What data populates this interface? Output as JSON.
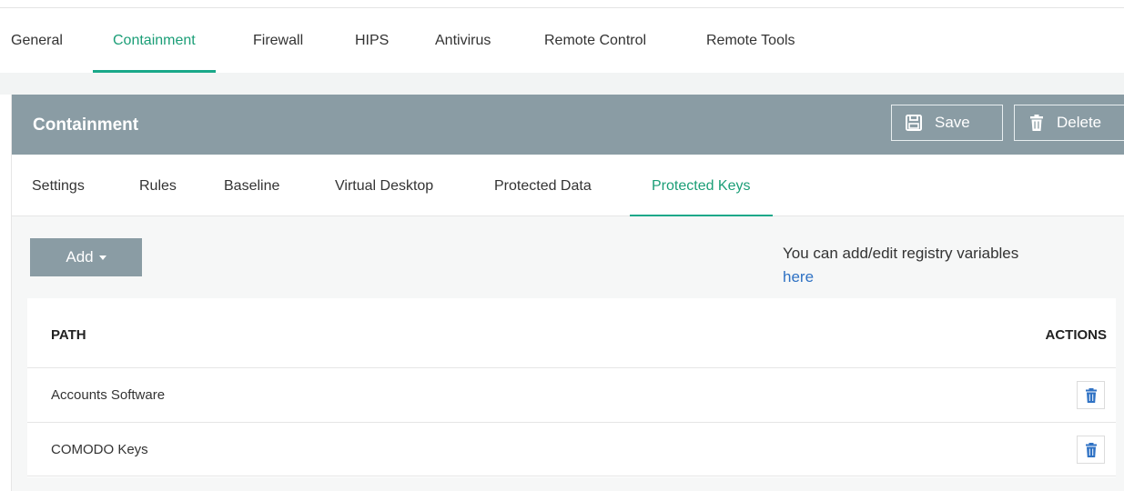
{
  "top_tabs": [
    {
      "label": "General"
    },
    {
      "label": "Containment",
      "active": true
    },
    {
      "label": "Firewall"
    },
    {
      "label": "HIPS"
    },
    {
      "label": "Antivirus"
    },
    {
      "label": "Remote Control"
    },
    {
      "label": "Remote Tools"
    }
  ],
  "panel": {
    "title": "Containment",
    "save_label": "Save",
    "delete_label": "Delete"
  },
  "sub_tabs": [
    {
      "label": "Settings"
    },
    {
      "label": "Rules"
    },
    {
      "label": "Baseline"
    },
    {
      "label": "Virtual Desktop"
    },
    {
      "label": "Protected Data"
    },
    {
      "label": "Protected Keys",
      "active": true
    }
  ],
  "toolbar": {
    "add_label": "Add",
    "info_text": "You can add/edit registry variables",
    "info_link": "here"
  },
  "table": {
    "columns": [
      "PATH",
      "ACTIONS"
    ],
    "rows": [
      {
        "path": "Accounts Software"
      },
      {
        "path": "COMODO Keys"
      }
    ]
  },
  "colors": {
    "accent": "#1aa889",
    "header_bg": "#8a9ca4",
    "link": "#2f72c4",
    "delete_icon": "#2f72c4"
  },
  "icons": {
    "save": "floppy-disk-icon",
    "delete": "trash-icon",
    "row_delete": "trash-icon",
    "add_menu": "caret-down-icon"
  }
}
